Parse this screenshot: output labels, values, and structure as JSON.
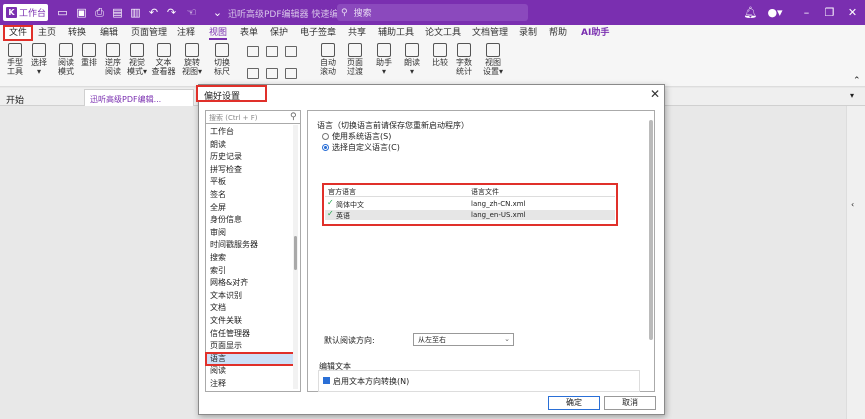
{
  "titlebar": {
    "app_button": "工作台",
    "title": "迅听高级PDF编辑器 快速编辑",
    "search_placeholder": "搜索"
  },
  "menu": {
    "items": [
      "文件",
      "主页",
      "转换",
      "编辑",
      "页面管理",
      "注释",
      "视图",
      "表单",
      "保护",
      "电子签章",
      "共享",
      "辅助工具",
      "论文工具",
      "文档管理",
      "录制",
      "帮助",
      "AI助手"
    ],
    "active": "视图"
  },
  "toolbar": {
    "tools": [
      {
        "label1": "手型",
        "label2": "工具"
      },
      {
        "label1": "选择",
        "label2": "▾"
      },
      {
        "label1": "阅读",
        "label2": "模式"
      },
      {
        "label1": "重排",
        "label2": ""
      },
      {
        "label1": "逆序",
        "label2": "阅读"
      },
      {
        "label1": "视觉",
        "label2": "模式▾"
      },
      {
        "label1": "文本",
        "label2": "查看器"
      },
      {
        "label1": "旋转",
        "label2": "视图▾"
      },
      {
        "label1": "切换",
        "label2": "标尺"
      },
      {
        "label1": "自动",
        "label2": "滚动"
      },
      {
        "label1": "页面",
        "label2": "过渡"
      },
      {
        "label1": "助手",
        "label2": "▾"
      },
      {
        "label1": "朗读",
        "label2": "▾"
      },
      {
        "label1": "比较",
        "label2": ""
      },
      {
        "label1": "字数",
        "label2": "统计"
      },
      {
        "label1": "视图",
        "label2": "设置▾"
      }
    ]
  },
  "tabs": {
    "start": "开始",
    "doc": "迅听高级PDF编辑..."
  },
  "dialog": {
    "title": "偏好设置",
    "nav_search_placeholder": "搜索 (Ctrl + F)",
    "nav_items": [
      "工作台",
      "朗读",
      "历史记录",
      "拼写检查",
      "平板",
      "签名",
      "全屏",
      "身份信息",
      "审阅",
      "时间戳服务器",
      "搜索",
      "索引",
      "网格&对齐",
      "文本识别",
      "文档",
      "文件关联",
      "信任管理器",
      "页面显示",
      "语言",
      "阅读",
      "注释"
    ],
    "selected_nav": "语言",
    "language_section_title": "语言（切换语言前请保存您重新启动程序）",
    "radio_system": "使用系统语言(S)",
    "radio_custom": "选择自定义语言(C)",
    "table_headers": {
      "lang": "官方语言",
      "file": "语言文件"
    },
    "languages": [
      {
        "name": "简体中文",
        "file": "lang_zh-CN.xml"
      },
      {
        "name": "英语",
        "file": "lang_en-US.xml"
      }
    ],
    "reading_direction_label": "默认阅读方向:",
    "reading_direction_value": "从左至右",
    "edit_text_section": "编辑文本",
    "edit_text_checkbox": "启用文本方向转换(N)",
    "ok": "确定",
    "cancel": "取消"
  },
  "colors": {
    "brand": "#7a2fb0",
    "highlight": "#e0302a",
    "selection": "#cde0f7"
  }
}
